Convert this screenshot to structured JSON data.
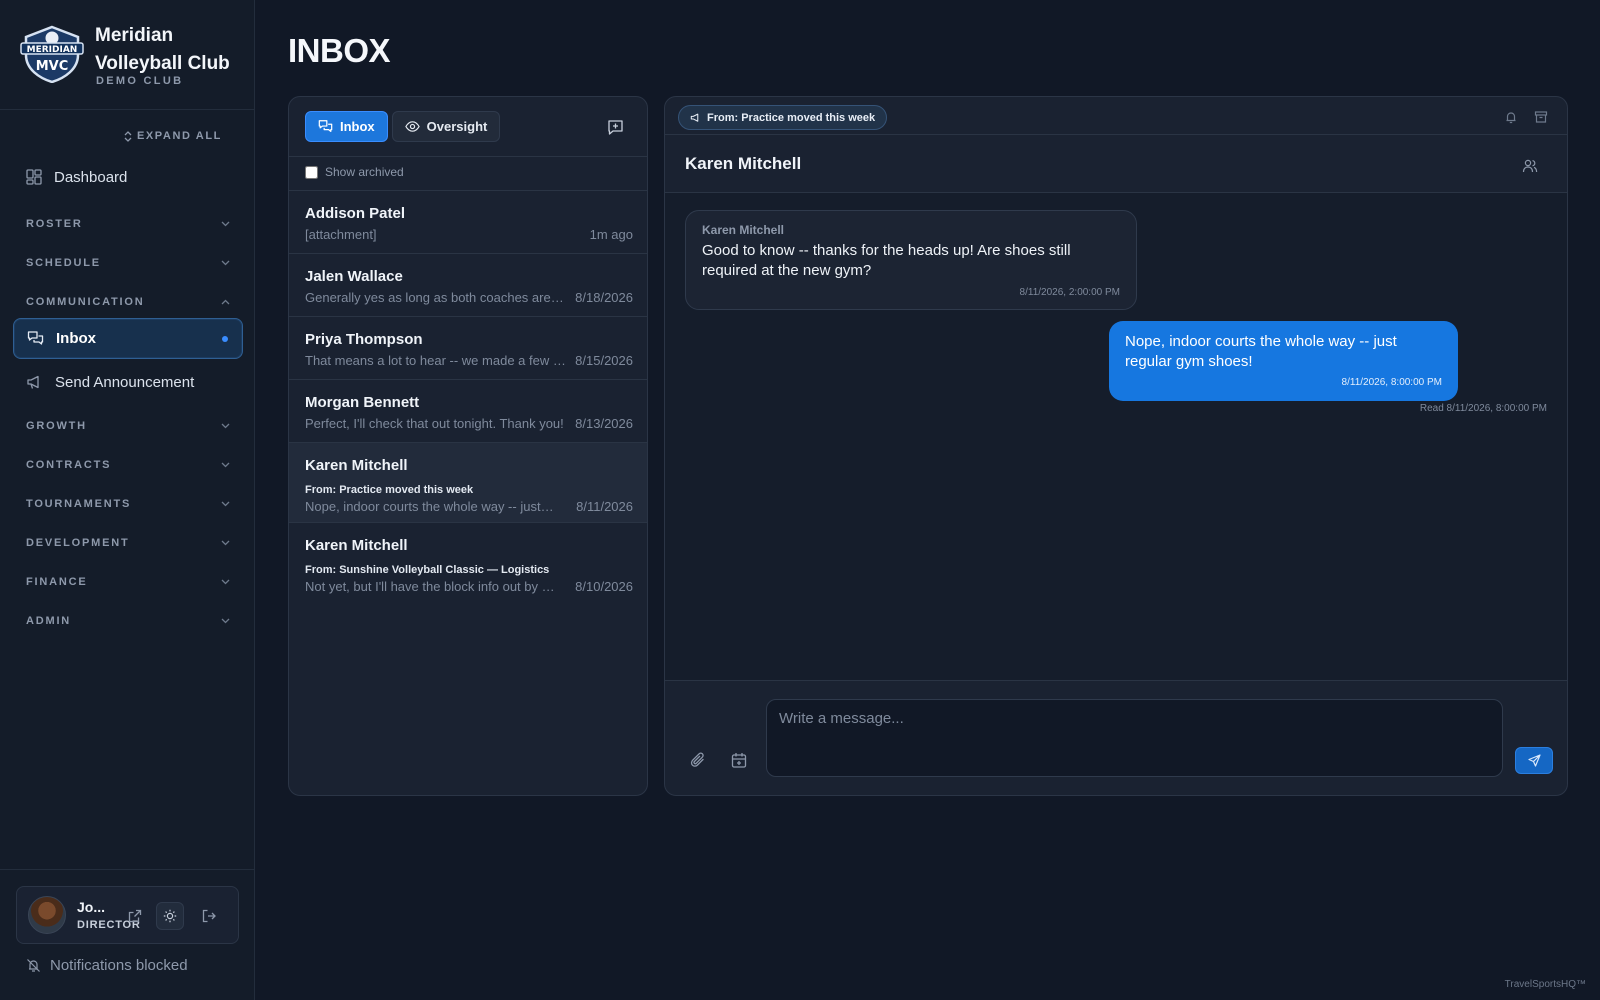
{
  "brand": {
    "name_line1": "Meridian",
    "name_line2": "Volleyball Club",
    "subtitle": "DEMO CLUB",
    "logo_text": "MERIDIAN",
    "logo_initials": "MVC"
  },
  "sidebar": {
    "expand_all": "EXPAND ALL",
    "dashboard": "Dashboard",
    "sections": {
      "roster": "ROSTER",
      "schedule": "SCHEDULE",
      "communication": "COMMUNICATION",
      "growth": "GROWTH",
      "contracts": "CONTRACTS",
      "tournaments": "TOURNAMENTS",
      "development": "DEVELOPMENT",
      "finance": "FINANCE",
      "admin": "ADMIN"
    },
    "inbox": "Inbox",
    "send_announcement": "Send Announcement"
  },
  "user": {
    "name": "Jo...",
    "role": "DIRECTOR",
    "notifications": "Notifications blocked"
  },
  "page": {
    "title": "INBOX"
  },
  "list": {
    "tabs": {
      "inbox": "Inbox",
      "oversight": "Oversight"
    },
    "show_archived": "Show archived",
    "conversations": [
      {
        "name": "Addison Patel",
        "subject": "",
        "preview": "[attachment]",
        "date": "1m ago"
      },
      {
        "name": "Jalen Wallace",
        "subject": "",
        "preview": "Generally yes as long as both coaches are l...",
        "date": "8/18/2026"
      },
      {
        "name": "Priya Thompson",
        "subject": "",
        "preview": "That means a lot to hear -- we made a few r...",
        "date": "8/15/2026"
      },
      {
        "name": "Morgan Bennett",
        "subject": "",
        "preview": "Perfect, I'll check that out tonight. Thank you!",
        "date": "8/13/2026"
      },
      {
        "name": "Karen Mitchell",
        "subject": "From: Practice moved this week",
        "preview": "Nope, indoor courts the whole way -- just re...",
        "date": "8/11/2026"
      },
      {
        "name": "Karen Mitchell",
        "subject": "From: Sunshine Volleyball Classic — Logistics",
        "preview": "Not yet, but I'll have the block info out by Fr...",
        "date": "8/10/2026"
      }
    ]
  },
  "chat": {
    "context": "From: Practice moved this week",
    "title": "Karen Mitchell",
    "messages": [
      {
        "sender": "Karen Mitchell",
        "text": "Good to know -- thanks for the heads up! Are shoes still required at the new gym?",
        "time": "8/11/2026, 2:00:00 PM"
      },
      {
        "text": "Nope, indoor courts the whole way -- just regular gym shoes!",
        "time": "8/11/2026, 8:00:00 PM",
        "read": "Read 8/11/2026, 8:00:00 PM"
      }
    ],
    "compose_placeholder": "Write a message..."
  },
  "footer": {
    "watermark": "TravelSportsHQ™"
  },
  "colors": {
    "accent": "#1677e0",
    "background": "#111826",
    "panel": "#1a2231"
  },
  "icons": [
    "dashboard-icon",
    "inbox-icon",
    "megaphone-icon",
    "eye-icon",
    "new-message-icon",
    "bell-icon",
    "archive-icon",
    "users-icon",
    "paperclip-icon",
    "calendar-plus-icon",
    "send-icon",
    "sun-icon",
    "external-link-icon",
    "logout-icon",
    "bell-off-icon"
  ]
}
